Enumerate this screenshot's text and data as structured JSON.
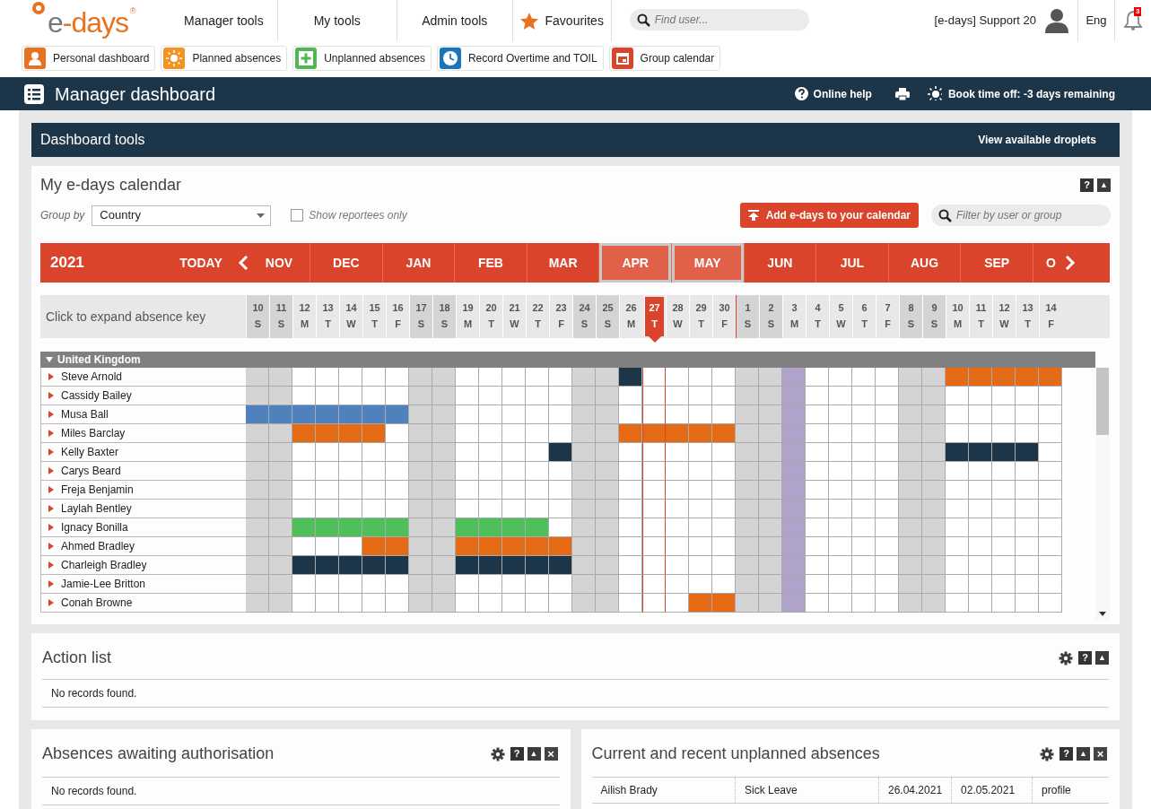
{
  "logo": {
    "text": "e-days",
    "mark": "®"
  },
  "menu": [
    {
      "label": "Manager tools",
      "kind": "plain"
    },
    {
      "label": "My tools",
      "kind": "plain"
    },
    {
      "label": "Admin tools",
      "kind": "plain"
    },
    {
      "label": "Favourites",
      "kind": "star"
    }
  ],
  "search": {
    "placeholder": "Find user..."
  },
  "user": {
    "name": "[e-days] Support 20",
    "language": "Eng",
    "notifications": "3"
  },
  "shortcuts": [
    {
      "label": "Personal dashboard",
      "kind": "person",
      "color": "#e8731f"
    },
    {
      "label": "Planned absences",
      "kind": "sun",
      "color": "#f39322"
    },
    {
      "label": "Unplanned absences",
      "kind": "plus",
      "color": "#4cb84f"
    },
    {
      "label": "Record Overtime and TOIL",
      "kind": "clock",
      "color": "#1b75bb"
    },
    {
      "label": "Group calendar",
      "kind": "calendar",
      "color": "#d9442b"
    }
  ],
  "page_title": "Manager dashboard",
  "title_actions": {
    "help": "Online help",
    "book": "Book time off: **-3 days** remaining"
  },
  "tools_bar": {
    "title": "Dashboard tools",
    "link": "View available droplets"
  },
  "calendar": {
    "title": "My e-days calendar",
    "tools": [
      {
        "kind": "help",
        "label": "?"
      },
      {
        "kind": "collapse",
        "label": "▲"
      }
    ],
    "group_by_label": "Group by",
    "group_by": "Country",
    "reportees_label": "Show reportees only",
    "reportees_only": false,
    "add_button": "Add e-days to your calendar",
    "filter_placeholder": "Filter by user or group",
    "year": "2021",
    "today_button": "TODAY",
    "months": [
      {
        "label": "NOV",
        "in_view": false
      },
      {
        "label": "DEC",
        "in_view": false
      },
      {
        "label": "JAN",
        "in_view": false
      },
      {
        "label": "FEB",
        "in_view": false
      },
      {
        "label": "MAR",
        "in_view": false
      },
      {
        "label": "APR",
        "in_view": true
      },
      {
        "label": "MAY",
        "in_view": true
      },
      {
        "label": "JUN",
        "in_view": false
      },
      {
        "label": "JUL",
        "in_view": false
      },
      {
        "label": "AUG",
        "in_view": false
      },
      {
        "label": "SEP",
        "in_view": false
      },
      {
        "label": "O",
        "in_view": false
      }
    ],
    "key_label": "Click to expand absence key",
    "days": [
      {
        "day": "10",
        "weekday": "S",
        "kind": "weekend",
        "today": false,
        "month_start": false
      },
      {
        "day": "11",
        "weekday": "S",
        "kind": "weekend",
        "today": false,
        "month_start": false
      },
      {
        "day": "12",
        "weekday": "M",
        "kind": "workday",
        "today": false,
        "month_start": false
      },
      {
        "day": "13",
        "weekday": "T",
        "kind": "workday",
        "today": false,
        "month_start": false
      },
      {
        "day": "14",
        "weekday": "W",
        "kind": "workday",
        "today": false,
        "month_start": false
      },
      {
        "day": "15",
        "weekday": "T",
        "kind": "workday",
        "today": false,
        "month_start": false
      },
      {
        "day": "16",
        "weekday": "F",
        "kind": "workday",
        "today": false,
        "month_start": false
      },
      {
        "day": "17",
        "weekday": "S",
        "kind": "weekend",
        "today": false,
        "month_start": false
      },
      {
        "day": "18",
        "weekday": "S",
        "kind": "weekend",
        "today": false,
        "month_start": false
      },
      {
        "day": "19",
        "weekday": "M",
        "kind": "workday",
        "today": false,
        "month_start": false
      },
      {
        "day": "20",
        "weekday": "T",
        "kind": "workday",
        "today": false,
        "month_start": false
      },
      {
        "day": "21",
        "weekday": "W",
        "kind": "workday",
        "today": false,
        "month_start": false
      },
      {
        "day": "22",
        "weekday": "T",
        "kind": "workday",
        "today": false,
        "month_start": false
      },
      {
        "day": "23",
        "weekday": "F",
        "kind": "workday",
        "today": false,
        "month_start": false
      },
      {
        "day": "24",
        "weekday": "S",
        "kind": "weekend",
        "today": false,
        "month_start": false
      },
      {
        "day": "25",
        "weekday": "S",
        "kind": "weekend",
        "today": false,
        "month_start": false
      },
      {
        "day": "26",
        "weekday": "M",
        "kind": "workday",
        "today": false,
        "month_start": false
      },
      {
        "day": "27",
        "weekday": "T",
        "kind": "workday",
        "today": true,
        "month_start": false
      },
      {
        "day": "28",
        "weekday": "W",
        "kind": "workday",
        "today": false,
        "month_start": false
      },
      {
        "day": "29",
        "weekday": "T",
        "kind": "workday",
        "today": false,
        "month_start": false
      },
      {
        "day": "30",
        "weekday": "F",
        "kind": "workday",
        "today": false,
        "month_start": false
      },
      {
        "day": "1",
        "weekday": "S",
        "kind": "weekend",
        "today": false,
        "month_start": true
      },
      {
        "day": "2",
        "weekday": "S",
        "kind": "weekend",
        "today": false,
        "month_start": false
      },
      {
        "day": "3",
        "weekday": "M",
        "kind": "holiday",
        "today": false,
        "month_start": false
      },
      {
        "day": "4",
        "weekday": "T",
        "kind": "workday",
        "today": false,
        "month_start": false
      },
      {
        "day": "5",
        "weekday": "W",
        "kind": "workday",
        "today": false,
        "month_start": false
      },
      {
        "day": "6",
        "weekday": "T",
        "kind": "workday",
        "today": false,
        "month_start": false
      },
      {
        "day": "7",
        "weekday": "F",
        "kind": "workday",
        "today": false,
        "month_start": false
      },
      {
        "day": "8",
        "weekday": "S",
        "kind": "weekend",
        "today": false,
        "month_start": false
      },
      {
        "day": "9",
        "weekday": "S",
        "kind": "weekend",
        "today": false,
        "month_start": false
      },
      {
        "day": "10",
        "weekday": "M",
        "kind": "workday",
        "today": false,
        "month_start": false
      },
      {
        "day": "11",
        "weekday": "T",
        "kind": "workday",
        "today": false,
        "month_start": false
      },
      {
        "day": "12",
        "weekday": "W",
        "kind": "workday",
        "today": false,
        "month_start": false
      },
      {
        "day": "13",
        "weekday": "T",
        "kind": "workday",
        "today": false,
        "month_start": false
      },
      {
        "day": "14",
        "weekday": "F",
        "kind": "workday",
        "today": false,
        "month_start": false
      }
    ],
    "group": {
      "name": "United Kingdom",
      "expanded": true
    },
    "people": [
      {
        "name": "Steve Arnold",
        "cells": [
          null,
          null,
          null,
          null,
          null,
          null,
          null,
          null,
          null,
          null,
          null,
          null,
          null,
          null,
          null,
          null,
          {
            "color": "#1c3549"
          },
          null,
          null,
          null,
          null,
          null,
          null,
          null,
          null,
          null,
          null,
          null,
          null,
          null,
          {
            "color": "#e56a16"
          },
          {
            "color": "#e56a16"
          },
          {
            "color": "#e56a16"
          },
          {
            "color": "#e56a16"
          },
          {
            "color": "#e56a16"
          }
        ]
      },
      {
        "name": "Cassidy Bailey"
      },
      {
        "name": "Musa Ball",
        "cells": [
          {
            "color": "#4f81bd"
          },
          {
            "color": "#4f81bd"
          },
          {
            "color": "#4f81bd"
          },
          {
            "color": "#4f81bd"
          },
          {
            "color": "#4f81bd"
          },
          {
            "color": "#4f81bd"
          },
          {
            "color": "#4f81bd"
          }
        ]
      },
      {
        "name": "Miles Barclay",
        "cells": [
          null,
          null,
          {
            "color": "#e56a16"
          },
          {
            "color": "#e56a16"
          },
          {
            "color": "#e56a16"
          },
          {
            "color": "#e56a16"
          },
          null,
          null,
          null,
          null,
          null,
          null,
          null,
          null,
          null,
          null,
          {
            "color": "#e56a16"
          },
          {
            "color": "#e56a16"
          },
          {
            "color": "#e56a16"
          },
          {
            "color": "#e56a16"
          },
          {
            "color": "#e56a16"
          }
        ]
      },
      {
        "name": "Kelly Baxter",
        "cells": [
          null,
          null,
          null,
          null,
          null,
          null,
          null,
          null,
          null,
          null,
          null,
          null,
          null,
          {
            "color": "#1c3549"
          },
          null,
          null,
          null,
          null,
          null,
          null,
          null,
          null,
          null,
          null,
          null,
          null,
          null,
          null,
          null,
          null,
          {
            "color": "#1c3549"
          },
          {
            "color": "#1c3549"
          },
          {
            "color": "#1c3549"
          },
          {
            "color": "#1c3549"
          }
        ]
      },
      {
        "name": "Carys Beard"
      },
      {
        "name": "Freja Benjamin"
      },
      {
        "name": "Laylah Bentley"
      },
      {
        "name": "Ignacy Bonilla",
        "cells": [
          null,
          null,
          {
            "color": "#4fbf5a"
          },
          {
            "color": "#4fbf5a"
          },
          {
            "color": "#4fbf5a"
          },
          {
            "color": "#4fbf5a"
          },
          {
            "color": "#4fbf5a"
          },
          null,
          null,
          {
            "color": "#4fbf5a"
          },
          {
            "color": "#4fbf5a"
          },
          {
            "color": "#4fbf5a"
          },
          {
            "color": "#4fbf5a"
          }
        ]
      },
      {
        "name": "Ahmed Bradley",
        "cells": [
          null,
          null,
          null,
          null,
          null,
          {
            "color": "#e56a16"
          },
          {
            "color": "#e56a16"
          },
          null,
          null,
          {
            "color": "#e56a16"
          },
          {
            "color": "#e56a16"
          },
          {
            "color": "#e56a16"
          },
          {
            "color": "#e56a16"
          },
          {
            "color": "#e56a16"
          }
        ]
      },
      {
        "name": "Charleigh Bradley",
        "cells": [
          null,
          null,
          {
            "color": "#1c3549"
          },
          {
            "color": "#1c3549"
          },
          {
            "color": "#1c3549"
          },
          {
            "color": "#1c3549"
          },
          {
            "color": "#1c3549"
          },
          null,
          null,
          {
            "color": "#1c3549"
          },
          {
            "color": "#1c3549"
          },
          {
            "color": "#1c3549"
          },
          {
            "color": "#1c3549"
          },
          {
            "color": "#1c3549"
          }
        ]
      },
      {
        "name": "Jamie-Lee Britton"
      },
      {
        "name": "Conah Browne",
        "cells": [
          null,
          null,
          null,
          null,
          null,
          null,
          null,
          null,
          null,
          null,
          null,
          null,
          null,
          null,
          null,
          null,
          null,
          null,
          null,
          {
            "color": "#e56a16"
          },
          {
            "color": "#e56a16"
          }
        ]
      }
    ]
  },
  "action_list": {
    "title": "Action list",
    "tools": [
      {
        "kind": "settings"
      },
      {
        "kind": "help",
        "label": "?"
      },
      {
        "kind": "collapse",
        "label": "▲"
      }
    ],
    "empty": "No records found."
  },
  "awaiting": {
    "title": "Absences awaiting authorisation",
    "tools": [
      {
        "kind": "settings"
      },
      {
        "kind": "help",
        "label": "?"
      },
      {
        "kind": "collapse",
        "label": "▲"
      },
      {
        "kind": "close",
        "label": "×"
      }
    ],
    "empty": "No records found."
  },
  "unplanned": {
    "title": "Current and recent unplanned absences",
    "tools": [
      {
        "kind": "settings"
      },
      {
        "kind": "help",
        "label": "?"
      },
      {
        "kind": "collapse",
        "label": "▲"
      },
      {
        "kind": "close",
        "label": "×"
      }
    ],
    "rows": [
      {
        "name": "Ailish Brady",
        "type": "Sick Leave",
        "from": "26.04.2021",
        "to": "02.05.2021",
        "link": "profile"
      }
    ]
  }
}
